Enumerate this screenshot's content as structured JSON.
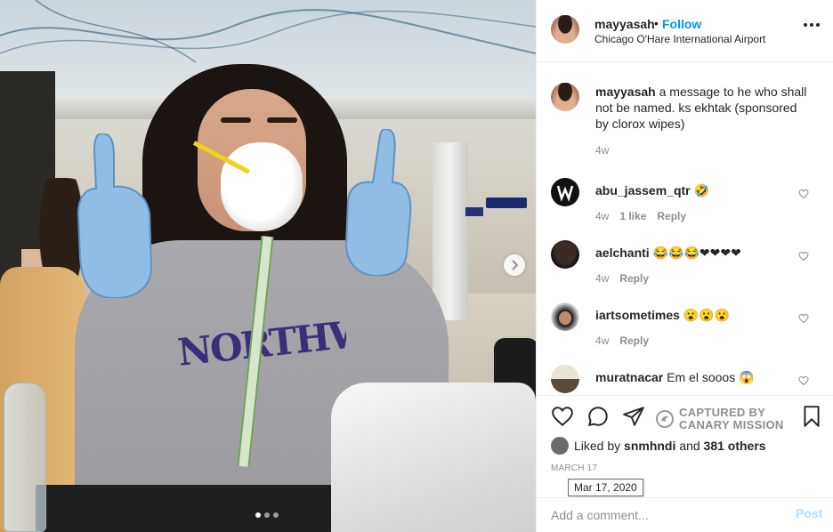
{
  "post": {
    "username": "mayyasah",
    "separator": "•",
    "follow_label": "Follow",
    "location": "Chicago O'Hare International Airport",
    "more_icon": "more-options-icon"
  },
  "caption": {
    "username": "mayyasah",
    "text": " a message to he who shall not be named. ks ekhtak (sponsored by clorox wipes)",
    "time": "4w"
  },
  "comments": [
    {
      "username": "abu_jassem_qtr",
      "text": " 🤣",
      "time": "4w",
      "likes": "1 like",
      "reply": "Reply"
    },
    {
      "username": "aelchanti",
      "text": " 😂😂😂❤❤❤❤",
      "time": "4w",
      "likes": "",
      "reply": "Reply"
    },
    {
      "username": "iartsometimes",
      "text": " 😮😮😮",
      "time": "4w",
      "likes": "",
      "reply": "Reply"
    },
    {
      "username": "muratnacar",
      "text": " Em el sooos 😱",
      "time": "",
      "likes": "",
      "reply": ""
    }
  ],
  "photo": {
    "carousel_dots": 3,
    "active_dot": 0,
    "sweater_text": "NORTHWESTER"
  },
  "watermark": {
    "line1": "CAPTURED BY",
    "line2": "CANARY MISSION"
  },
  "likes": {
    "prefix": "Liked by ",
    "user": "snmhndi",
    "middle": " and ",
    "others": "381 others"
  },
  "date": "MARCH 17",
  "date_tooltip": "Mar 17, 2020",
  "add_comment": {
    "placeholder": "Add a comment...",
    "post_label": "Post"
  },
  "colors": {
    "accent": "#0095f6",
    "post_disabled": "#b2dffc",
    "muted": "#8e8e8e",
    "text": "#262626"
  }
}
